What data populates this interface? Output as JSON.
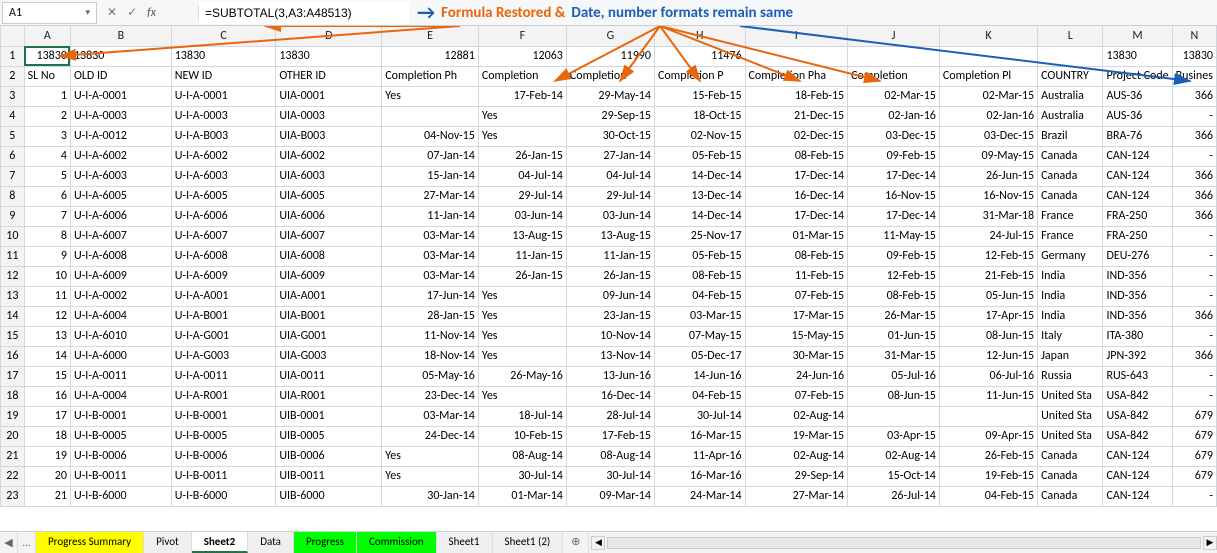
{
  "formula_bar": {
    "name_box": "A1",
    "fx_label": "fx",
    "formula": "=SUBTOTAL(3,A3:A48513)"
  },
  "annotation": {
    "arrow_glyph": "→",
    "part1": "Formula Restored & ",
    "part2": "Date, number formats remain same"
  },
  "columns": [
    "A",
    "B",
    "C",
    "D",
    "E",
    "F",
    "G",
    "H",
    "I",
    "J",
    "K",
    "L",
    "M",
    "N"
  ],
  "headers_row2": [
    "SL No",
    "OLD ID",
    "NEW ID",
    "OTHER ID",
    "Completion Ph",
    "Completion",
    "Completion",
    "Completion P",
    "Completion Pha",
    "Completion",
    "Completion Pl",
    "COUNTRY",
    "Project Code",
    "Busines"
  ],
  "row1": [
    "13830",
    "13830",
    "13830",
    "13830",
    "12881",
    "12063",
    "11990",
    "11476",
    "",
    "",
    "",
    "",
    "13830",
    "13830"
  ],
  "rows": [
    {
      "n": 3,
      "c": [
        "1",
        "U-I-A-0001",
        "U-I-A-0001",
        "UIA-0001",
        "Yes",
        "17-Feb-14",
        "29-May-14",
        "15-Feb-15",
        "18-Feb-15",
        "02-Mar-15",
        "02-Mar-15",
        "Australia",
        "AUS-36",
        "366"
      ]
    },
    {
      "n": 4,
      "c": [
        "2",
        "U-I-A-0003",
        "U-I-A-0003",
        "UIA-0003",
        "",
        "Yes",
        "29-Sep-15",
        "18-Oct-15",
        "21-Dec-15",
        "02-Jan-16",
        "02-Jan-16",
        "Australia",
        "AUS-36",
        "-"
      ]
    },
    {
      "n": 5,
      "c": [
        "3",
        "U-I-A-0012",
        "U-I-A-B003",
        "UIA-B003",
        "04-Nov-15",
        "Yes",
        "30-Oct-15",
        "02-Nov-15",
        "02-Dec-15",
        "03-Dec-15",
        "03-Dec-15",
        "Brazil",
        "BRA-76",
        "366"
      ]
    },
    {
      "n": 6,
      "c": [
        "4",
        "U-I-A-6002",
        "U-I-A-6002",
        "UIA-6002",
        "07-Jan-14",
        "26-Jan-15",
        "27-Jan-14",
        "05-Feb-15",
        "08-Feb-15",
        "09-Feb-15",
        "09-May-15",
        "Canada",
        "CAN-124",
        "-"
      ]
    },
    {
      "n": 7,
      "c": [
        "5",
        "U-I-A-6003",
        "U-I-A-6003",
        "UIA-6003",
        "15-Jan-14",
        "04-Jul-14",
        "04-Jul-14",
        "14-Dec-14",
        "17-Dec-14",
        "17-Dec-14",
        "26-Jun-15",
        "Canada",
        "CAN-124",
        "366"
      ]
    },
    {
      "n": 8,
      "c": [
        "6",
        "U-I-A-6005",
        "U-I-A-6005",
        "UIA-6005",
        "27-Mar-14",
        "29-Jul-14",
        "29-Jul-14",
        "13-Dec-14",
        "16-Dec-14",
        "16-Nov-15",
        "16-Nov-15",
        "Canada",
        "CAN-124",
        "366"
      ]
    },
    {
      "n": 9,
      "c": [
        "7",
        "U-I-A-6006",
        "U-I-A-6006",
        "UIA-6006",
        "11-Jan-14",
        "03-Jun-14",
        "03-Jun-14",
        "14-Dec-14",
        "17-Dec-14",
        "17-Dec-14",
        "31-Mar-18",
        "France",
        "FRA-250",
        "366"
      ]
    },
    {
      "n": 10,
      "c": [
        "8",
        "U-I-A-6007",
        "U-I-A-6007",
        "UIA-6007",
        "03-Mar-14",
        "13-Aug-15",
        "13-Aug-15",
        "25-Nov-17",
        "01-Mar-15",
        "11-May-15",
        "24-Jul-15",
        "France",
        "FRA-250",
        "-"
      ]
    },
    {
      "n": 11,
      "c": [
        "9",
        "U-I-A-6008",
        "U-I-A-6008",
        "UIA-6008",
        "03-Mar-14",
        "11-Jan-15",
        "11-Jan-15",
        "05-Feb-15",
        "08-Feb-15",
        "09-Feb-15",
        "12-Feb-15",
        "Germany",
        "DEU-276",
        "-"
      ]
    },
    {
      "n": 12,
      "c": [
        "10",
        "U-I-A-6009",
        "U-I-A-6009",
        "UIA-6009",
        "03-Mar-14",
        "26-Jan-15",
        "26-Jan-15",
        "08-Feb-15",
        "11-Feb-15",
        "12-Feb-15",
        "21-Feb-15",
        "India",
        "IND-356",
        "-"
      ]
    },
    {
      "n": 13,
      "c": [
        "11",
        "U-I-A-0002",
        "U-I-A-A001",
        "UIA-A001",
        "17-Jun-14",
        "Yes",
        "09-Jun-14",
        "04-Feb-15",
        "07-Feb-15",
        "08-Feb-15",
        "05-Jun-15",
        "India",
        "IND-356",
        "-"
      ]
    },
    {
      "n": 14,
      "c": [
        "12",
        "U-I-A-6004",
        "U-I-A-B001",
        "UIA-B001",
        "28-Jan-15",
        "Yes",
        "23-Jan-15",
        "03-Mar-15",
        "17-Mar-15",
        "26-Mar-15",
        "17-Apr-15",
        "India",
        "IND-356",
        "366"
      ]
    },
    {
      "n": 15,
      "c": [
        "13",
        "U-I-A-6010",
        "U-I-A-G001",
        "UIA-G001",
        "11-Nov-14",
        "Yes",
        "10-Nov-14",
        "07-May-15",
        "15-May-15",
        "01-Jun-15",
        "08-Jun-15",
        "Italy",
        "ITA-380",
        "-"
      ]
    },
    {
      "n": 16,
      "c": [
        "14",
        "U-I-A-6000",
        "U-I-A-G003",
        "UIA-G003",
        "18-Nov-14",
        "Yes",
        "13-Nov-14",
        "05-Dec-17",
        "30-Mar-15",
        "31-Mar-15",
        "12-Jun-15",
        "Japan",
        "JPN-392",
        "366"
      ]
    },
    {
      "n": 17,
      "c": [
        "15",
        "U-I-A-0011",
        "U-I-A-0011",
        "UIA-0011",
        "05-May-16",
        "26-May-16",
        "13-Jun-16",
        "14-Jun-16",
        "24-Jun-16",
        "05-Jul-16",
        "06-Jul-16",
        "Russia",
        "RUS-643",
        "-"
      ]
    },
    {
      "n": 18,
      "c": [
        "16",
        "U-I-A-0004",
        "U-I-A-R001",
        "UIA-R001",
        "23-Dec-14",
        "Yes",
        "16-Dec-14",
        "04-Feb-15",
        "07-Feb-15",
        "08-Jun-15",
        "11-Jun-15",
        "United Sta",
        "USA-842",
        "-"
      ]
    },
    {
      "n": 19,
      "c": [
        "17",
        "U-I-B-0001",
        "U-I-B-0001",
        "UIB-0001",
        "03-Mar-14",
        "18-Jul-14",
        "28-Jul-14",
        "30-Jul-14",
        "02-Aug-14",
        "",
        "",
        "United Sta",
        "USA-842",
        "679"
      ]
    },
    {
      "n": 20,
      "c": [
        "18",
        "U-I-B-0005",
        "U-I-B-0005",
        "UIB-0005",
        "24-Dec-14",
        "10-Feb-15",
        "17-Feb-15",
        "16-Mar-15",
        "19-Mar-15",
        "03-Apr-15",
        "09-Apr-15",
        "United Sta",
        "USA-842",
        "679"
      ]
    },
    {
      "n": 21,
      "c": [
        "19",
        "U-I-B-0006",
        "U-I-B-0006",
        "UIB-0006",
        "Yes",
        "08-Aug-14",
        "08-Aug-14",
        "11-Apr-16",
        "02-Aug-14",
        "02-Aug-14",
        "26-Feb-15",
        "Canada",
        "CAN-124",
        "679"
      ]
    },
    {
      "n": 22,
      "c": [
        "20",
        "U-I-B-0011",
        "U-I-B-0011",
        "UIB-0011",
        "Yes",
        "30-Jul-14",
        "30-Jul-14",
        "16-Mar-16",
        "29-Sep-14",
        "15-Oct-14",
        "19-Feb-15",
        "Canada",
        "CAN-124",
        "679"
      ]
    },
    {
      "n": 23,
      "c": [
        "21",
        "U-I-B-6000",
        "U-I-B-6000",
        "UIB-6000",
        "30-Jan-14",
        "01-Mar-14",
        "09-Mar-14",
        "24-Mar-14",
        "27-Mar-14",
        "26-Jul-14",
        "04-Feb-15",
        "Canada",
        "CAN-124",
        "-"
      ]
    }
  ],
  "tabs": {
    "ellipsis": "...",
    "items": [
      {
        "label": "Progress Summary",
        "cls": "yellow"
      },
      {
        "label": "Pivot",
        "cls": ""
      },
      {
        "label": "Sheet2",
        "cls": "active"
      },
      {
        "label": "Data",
        "cls": ""
      },
      {
        "label": "Progress",
        "cls": "green"
      },
      {
        "label": "Commission",
        "cls": "green"
      },
      {
        "label": "Sheet1",
        "cls": ""
      },
      {
        "label": "Sheet1 (2)",
        "cls": ""
      }
    ],
    "plus": "⊕"
  }
}
